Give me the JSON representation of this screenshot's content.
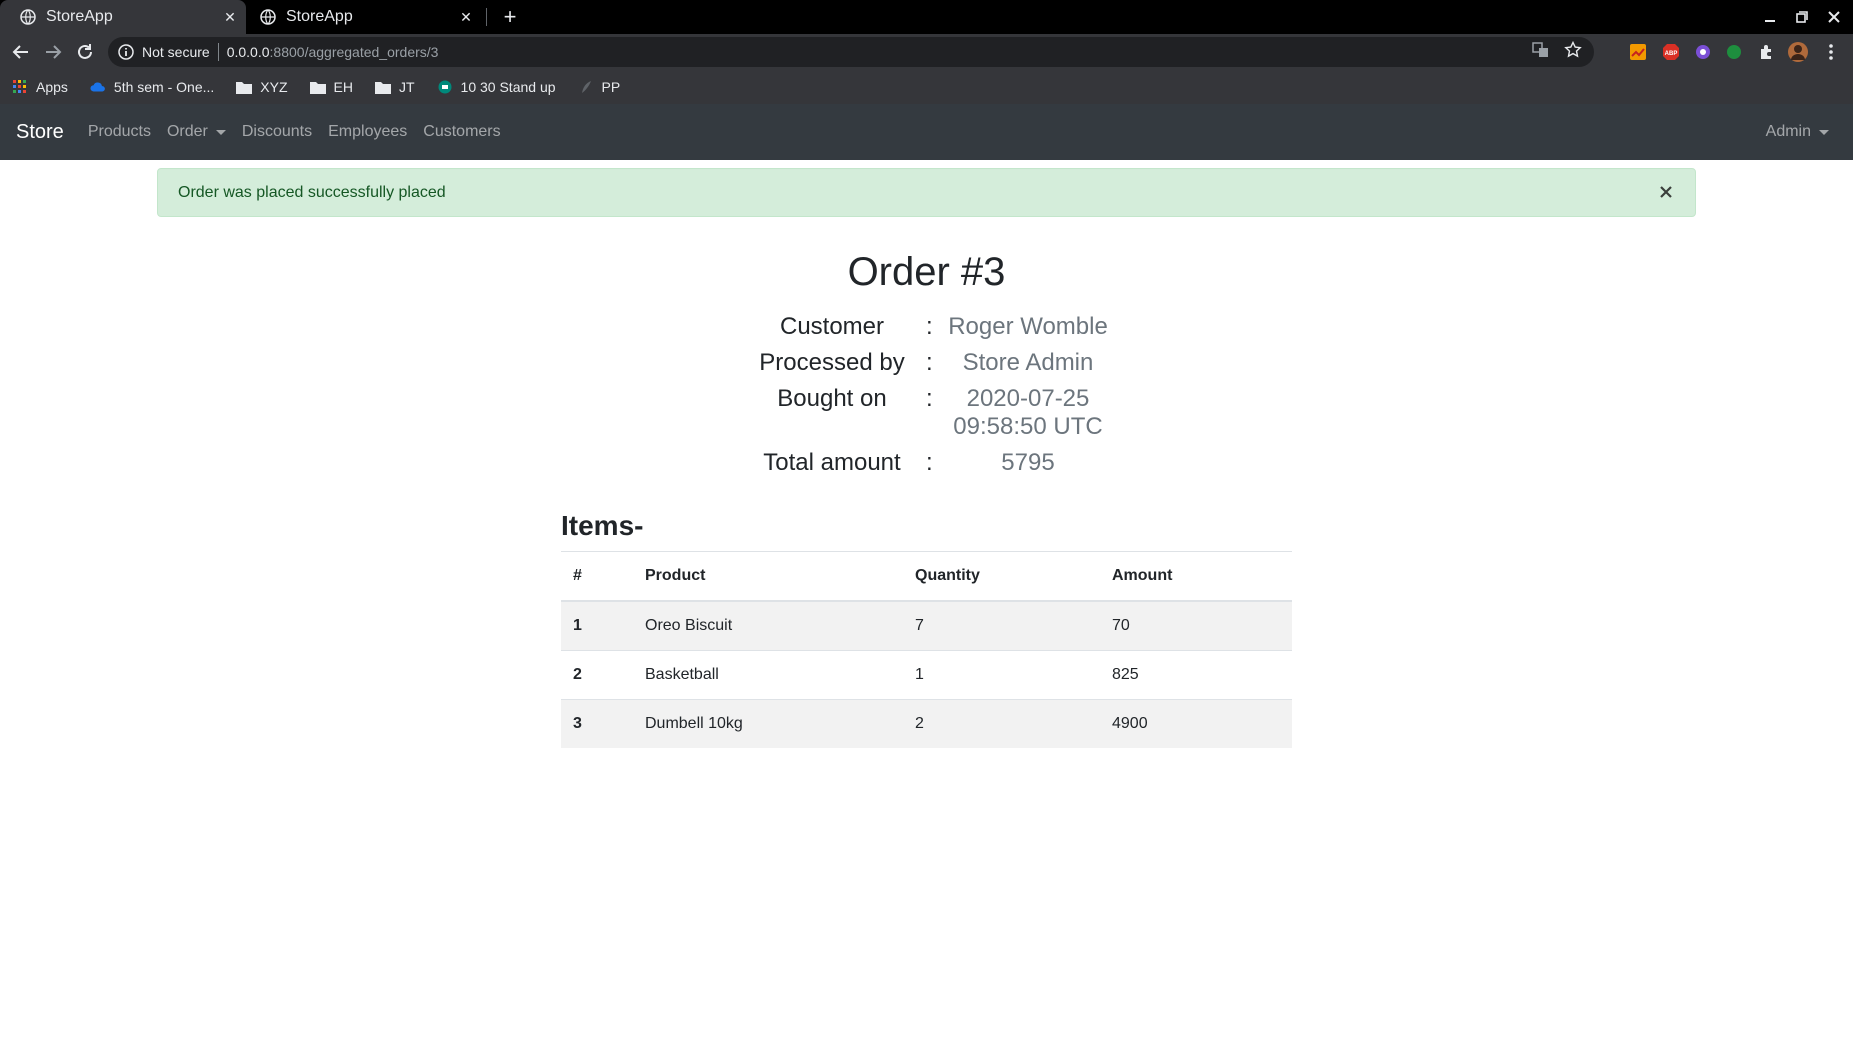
{
  "browser": {
    "tabs": [
      {
        "title": "StoreApp",
        "active": true
      },
      {
        "title": "StoreApp",
        "active": false
      }
    ],
    "security_label": "Not secure",
    "url_host": "0.0.0.0",
    "url_path": ":8800/aggregated_orders/3",
    "bookmarks": [
      "Apps",
      "5th sem - One...",
      "XYZ",
      "EH",
      "JT",
      "10 30 Stand up",
      "PP"
    ]
  },
  "navbar": {
    "brand": "Store",
    "links": [
      "Products",
      "Order",
      "Discounts",
      "Employees",
      "Customers"
    ],
    "user": "Admin"
  },
  "alert": {
    "message": "Order was placed successfully placed",
    "close_symbol": "×"
  },
  "order": {
    "title": "Order #3",
    "separator": ":",
    "fields": [
      {
        "label": "Customer",
        "value": "Roger Womble"
      },
      {
        "label": "Processed by",
        "value": "Store Admin"
      },
      {
        "label": "Bought on",
        "value_line1": "2020-07-25",
        "value_line2": "09:58:50 UTC"
      },
      {
        "label": "Total amount",
        "value": "5795"
      }
    ]
  },
  "items": {
    "heading": "Items-",
    "columns": [
      "#",
      "Product",
      "Quantity",
      "Amount"
    ],
    "rows": [
      {
        "num": "1",
        "product": "Oreo Biscuit",
        "quantity": "7",
        "amount": "70"
      },
      {
        "num": "2",
        "product": "Basketball",
        "quantity": "1",
        "amount": "825"
      },
      {
        "num": "3",
        "product": "Dumbell 10kg",
        "quantity": "2",
        "amount": "4900"
      }
    ]
  },
  "colors": {
    "navbar_bg": "#343a40",
    "alert_bg": "#d4edda",
    "alert_text": "#155724",
    "muted_value": "#6c757d"
  }
}
